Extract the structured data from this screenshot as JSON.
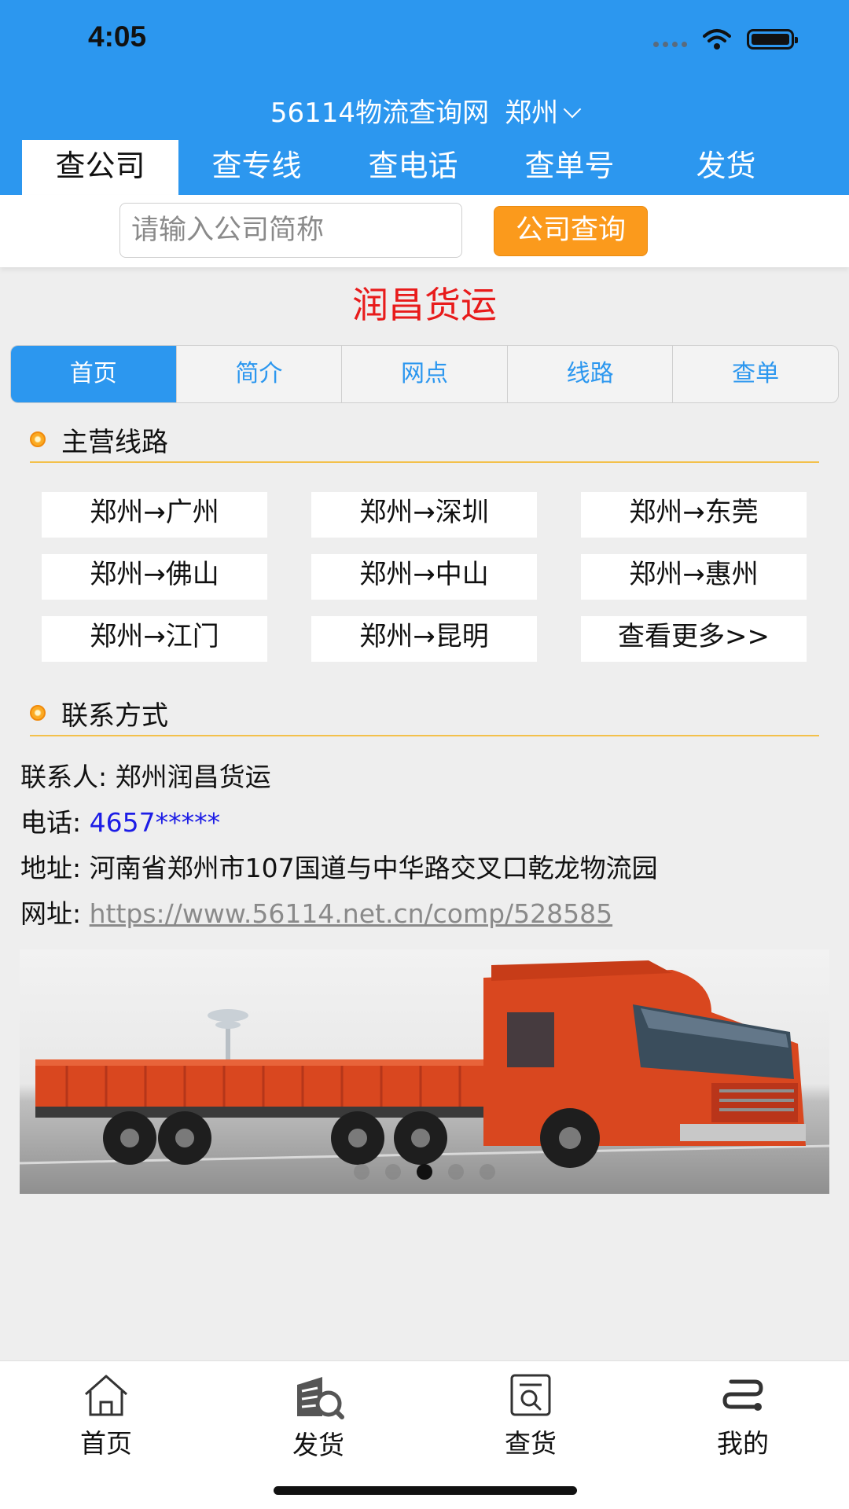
{
  "status_bar": {
    "time": "4:05"
  },
  "header": {
    "app_title": "56114物流查询网",
    "city": "郑州",
    "tabs": [
      {
        "label": "查公司",
        "active": true
      },
      {
        "label": "查专线",
        "active": false
      },
      {
        "label": "查电话",
        "active": false
      },
      {
        "label": "查单号",
        "active": false
      },
      {
        "label": "发货",
        "active": false
      }
    ]
  },
  "search": {
    "placeholder": "请输入公司简称",
    "button_label": "公司查询"
  },
  "company": {
    "name": "润昌货运",
    "tabs": [
      {
        "label": "首页",
        "active": true
      },
      {
        "label": "简介",
        "active": false
      },
      {
        "label": "网点",
        "active": false
      },
      {
        "label": "线路",
        "active": false
      },
      {
        "label": "查单",
        "active": false
      }
    ]
  },
  "routes_section": {
    "title": "主营线路",
    "routes": [
      "郑州→广州",
      "郑州→深圳",
      "郑州→东莞",
      "郑州→佛山",
      "郑州→中山",
      "郑州→惠州",
      "郑州→江门",
      "郑州→昆明",
      "查看更多>>"
    ]
  },
  "contact_section": {
    "title": "联系方式",
    "person_label": "联系人: ",
    "person": "郑州润昌货运",
    "phone_label": "电话: ",
    "phone": "4657*****",
    "address_label": "地址: ",
    "address": "河南省郑州市107国道与中华路交叉口乾龙物流园",
    "url_label": "网址: ",
    "url": "https://www.56114.net.cn/comp/528585"
  },
  "banner": {
    "image": "red-cargo-truck",
    "slide_count": 5,
    "active_slide": 3
  },
  "bottom_nav": [
    {
      "label": "首页",
      "icon": "home-icon"
    },
    {
      "label": "发货",
      "icon": "ship-goods-icon"
    },
    {
      "label": "查货",
      "icon": "search-goods-icon"
    },
    {
      "label": "我的",
      "icon": "route-icon"
    }
  ],
  "colors": {
    "primary": "#2c97ef",
    "accent": "#fb9a1c",
    "company_name": "#e81b1b",
    "phone": "#1c1ce6"
  }
}
